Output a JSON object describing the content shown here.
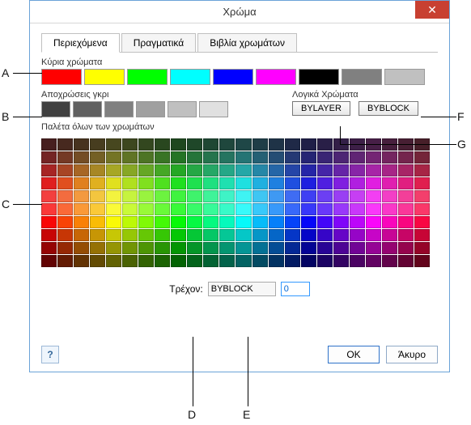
{
  "window": {
    "title": "Χρώμα",
    "close_glyph": "✕"
  },
  "tabs": {
    "t0": "Περιεχόμενα",
    "t1": "Πραγματικά",
    "t2": "Βιβλία χρωμάτων"
  },
  "groups": {
    "main_label": "Κύρια χρώματα",
    "grays_label": "Αποχρώσεις γκρι",
    "logical_label": "Λογικά Χρώματα",
    "palette_label": "Παλέτα όλων των χρωμάτων"
  },
  "main_colors": [
    "#f00",
    "#ff0",
    "#0f0",
    "#0ff",
    "#00f",
    "#f0f",
    "#000",
    "#808080",
    "#c0c0c0"
  ],
  "gray_colors": [
    "#404040",
    "#606060",
    "#808080",
    "#a0a0a0",
    "#c0c0c0",
    "#e0e0e0"
  ],
  "logical": {
    "bylayer": "BYLAYER",
    "byblock": "BYBLOCK"
  },
  "current": {
    "label": "Τρέχον:",
    "name": "BYBLOCK",
    "index": "0"
  },
  "buttons": {
    "help": "?",
    "ok": "OK",
    "cancel": "Άκυρο"
  },
  "annotations": {
    "A": "A",
    "B": "B",
    "C": "C",
    "D": "D",
    "E": "E",
    "F": "F",
    "G": "G"
  }
}
